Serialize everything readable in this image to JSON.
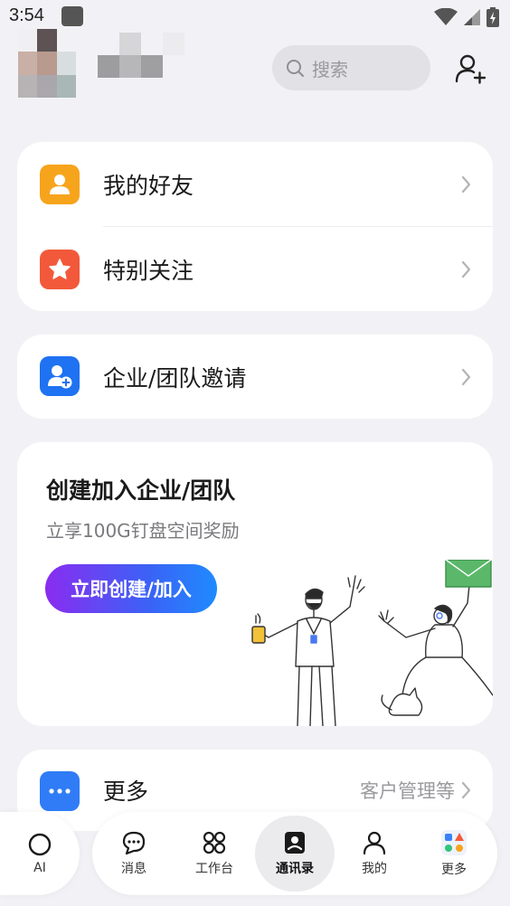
{
  "status": {
    "time": "3:54"
  },
  "header": {
    "search_placeholder": "搜索"
  },
  "quick_list": {
    "friends_label": "我的好友",
    "special_label": "特别关注"
  },
  "invite": {
    "label": "企业/团队邀请"
  },
  "promo": {
    "title": "创建加入企业/团队",
    "subtitle": "立享100G钉盘空间奖励",
    "button": "立即创建/加入"
  },
  "more": {
    "label": "更多",
    "extra": "客户管理等"
  },
  "colors": {
    "friends_icon": "#f7a41d",
    "special_icon": "#f2593a",
    "invite_icon": "#1f72f1",
    "more_icon": "#2f7cf6"
  },
  "nav": {
    "ai": "AI",
    "items": [
      "消息",
      "工作台",
      "通讯录",
      "我的",
      "更多"
    ],
    "active": "通讯录"
  }
}
